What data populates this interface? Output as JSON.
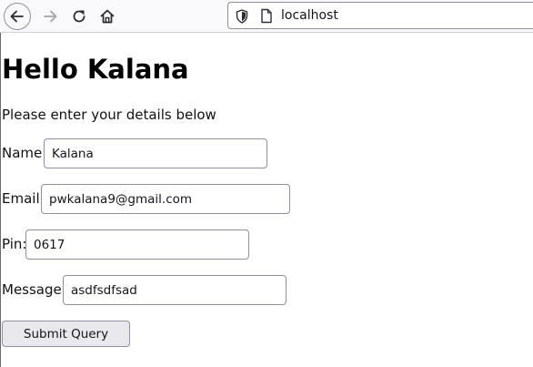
{
  "browser": {
    "url": "localhost"
  },
  "page": {
    "title": "Hello Kalana",
    "intro": "Please enter your details below",
    "fields": [
      {
        "label": "Name:",
        "value": "Kalana"
      },
      {
        "label": "Email:",
        "value": "pwkalana9@gmail.com"
      },
      {
        "label": "Pin:",
        "value": "0617"
      },
      {
        "label": "Message:",
        "value": "asdfsdfsad"
      }
    ],
    "submit_label": "Submit Query"
  }
}
